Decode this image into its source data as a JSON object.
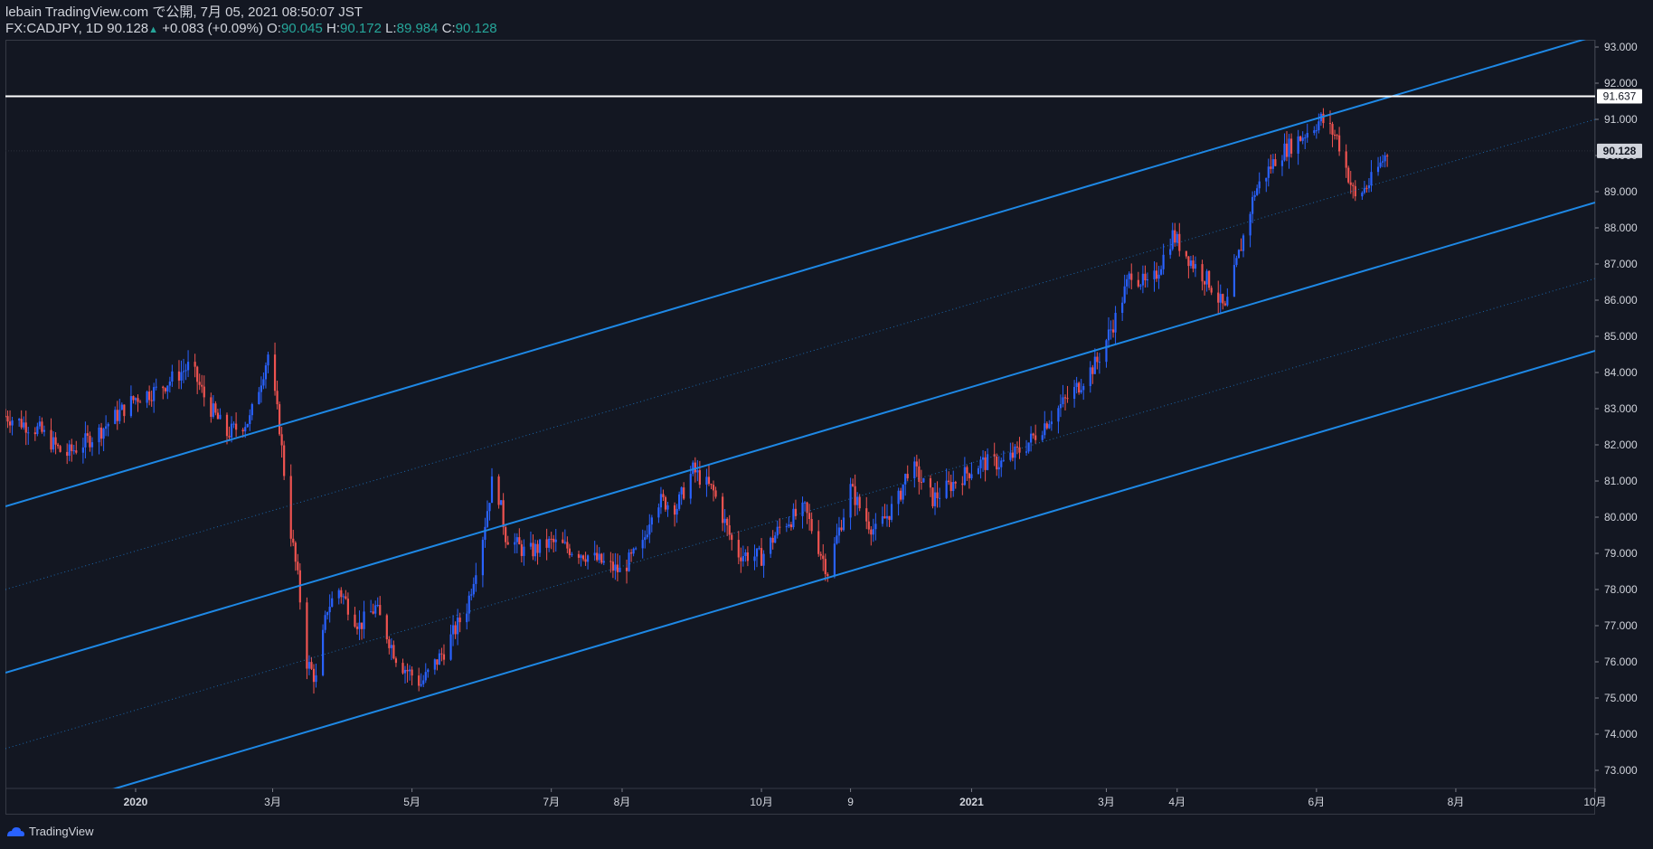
{
  "header": {
    "line1": "lebain TradingView.com で公開, 7月 05, 2021 08:50:07 JST",
    "symbol": "FX:CADJPY, 1D 90.128",
    "arrow": "▲",
    "change": "+0.083 (+0.09%)",
    "o_label": "O:",
    "o_value": "90.045",
    "h_label": "H:",
    "h_value": "90.172",
    "l_label": "L:",
    "l_value": "89.984",
    "c_label": "C:",
    "c_value": "90.128"
  },
  "footer": {
    "brand": "TradingView"
  },
  "colors": {
    "bg": "#131722",
    "up": "#2962ff",
    "down": "#ef5350",
    "channel": "#1e88e5",
    "level": "#ffffff",
    "text": "#d1d4dc"
  },
  "chart_data": {
    "type": "candlestick",
    "symbol": "FX:CADJPY",
    "interval": "1D",
    "ylim": [
      72.5,
      93.2
    ],
    "y_ticks": [
      "73.000",
      "74.000",
      "75.000",
      "76.000",
      "77.000",
      "78.000",
      "79.000",
      "80.000",
      "81.000",
      "82.000",
      "83.000",
      "84.000",
      "85.000",
      "86.000",
      "87.000",
      "88.000",
      "89.000",
      "90.000",
      "91.000",
      "92.000",
      "93.000"
    ],
    "x_ticks": [
      {
        "label": "2020",
        "date": "2020-01-01"
      },
      {
        "label": "3月",
        "date": "2020-03-01"
      },
      {
        "label": "5月",
        "date": "2020-05-01"
      },
      {
        "label": "7月",
        "date": "2020-07-01"
      },
      {
        "label": "8月",
        "date": "2020-08-01"
      },
      {
        "label": "10月",
        "date": "2020-10-01"
      },
      {
        "label": "9",
        "date": "2020-11-09"
      },
      {
        "label": "2021",
        "date": "2021-01-01"
      },
      {
        "label": "3月",
        "date": "2021-03-01"
      },
      {
        "label": "4月",
        "date": "2021-04-01"
      },
      {
        "label": "6月",
        "date": "2021-06-01"
      },
      {
        "label": "8月",
        "date": "2021-08-01"
      },
      {
        "label": "10月",
        "date": "2021-10-01"
      }
    ],
    "xlim": [
      "2019-11-05",
      "2021-10-01"
    ],
    "last_price": "90.128",
    "horizontal_level": {
      "label": "91.637",
      "value": 91.637
    },
    "channel_lines": [
      {
        "name": "upper",
        "p1": [
          "2019-11-05",
          80.3
        ],
        "p2": [
          "2021-10-01",
          93.3
        ],
        "style": "solid"
      },
      {
        "name": "upper-mid",
        "p1": [
          "2019-11-05",
          78.0
        ],
        "p2": [
          "2021-10-01",
          91.0
        ],
        "style": "dotted"
      },
      {
        "name": "middle",
        "p1": [
          "2019-11-05",
          75.7
        ],
        "p2": [
          "2021-10-01",
          88.7
        ],
        "style": "solid"
      },
      {
        "name": "lower-mid",
        "p1": [
          "2019-11-05",
          73.6
        ],
        "p2": [
          "2021-10-01",
          86.6
        ],
        "style": "dotted"
      },
      {
        "name": "lower",
        "p1": [
          "2019-11-05",
          71.6
        ],
        "p2": [
          "2021-10-01",
          84.6
        ],
        "style": "solid"
      }
    ],
    "path_points": [
      [
        "2019-11-05",
        82.8
      ],
      [
        "2019-11-20",
        82.4
      ],
      [
        "2019-12-01",
        81.7
      ],
      [
        "2019-12-15",
        82.3
      ],
      [
        "2020-01-01",
        83.3
      ],
      [
        "2020-01-10",
        83.5
      ],
      [
        "2020-01-25",
        84.2
      ],
      [
        "2020-02-01",
        83.2
      ],
      [
        "2020-02-10",
        82.3
      ],
      [
        "2020-02-20",
        82.7
      ],
      [
        "2020-02-28",
        84.5
      ],
      [
        "2020-03-04",
        82.5
      ],
      [
        "2020-03-08",
        80.0
      ],
      [
        "2020-03-12",
        78.3
      ],
      [
        "2020-03-16",
        76.0
      ],
      [
        "2020-03-20",
        75.5
      ],
      [
        "2020-03-25",
        77.5
      ],
      [
        "2020-03-30",
        78.0
      ],
      [
        "2020-04-08",
        77.0
      ],
      [
        "2020-04-15",
        77.5
      ],
      [
        "2020-04-25",
        76.0
      ],
      [
        "2020-05-05",
        75.4
      ],
      [
        "2020-05-15",
        76.3
      ],
      [
        "2020-05-25",
        77.5
      ],
      [
        "2020-06-01",
        79.5
      ],
      [
        "2020-06-06",
        81.3
      ],
      [
        "2020-06-11",
        79.5
      ],
      [
        "2020-06-20",
        79.0
      ],
      [
        "2020-07-01",
        79.3
      ],
      [
        "2020-07-15",
        79.0
      ],
      [
        "2020-07-31",
        78.5
      ],
      [
        "2020-08-10",
        79.2
      ],
      [
        "2020-08-15",
        80.5
      ],
      [
        "2020-08-25",
        80.3
      ],
      [
        "2020-09-01",
        81.3
      ],
      [
        "2020-09-10",
        80.7
      ],
      [
        "2020-09-20",
        79.0
      ],
      [
        "2020-10-01",
        78.9
      ],
      [
        "2020-10-10",
        79.8
      ],
      [
        "2020-10-20",
        80.2
      ],
      [
        "2020-10-30",
        78.5
      ],
      [
        "2020-11-09",
        80.8
      ],
      [
        "2020-11-15",
        80.0
      ],
      [
        "2020-11-20",
        79.6
      ],
      [
        "2020-11-30",
        80.5
      ],
      [
        "2020-12-05",
        81.5
      ],
      [
        "2020-12-15",
        80.5
      ],
      [
        "2020-12-25",
        81.0
      ],
      [
        "2021-01-05",
        81.5
      ],
      [
        "2021-01-15",
        81.5
      ],
      [
        "2021-01-25",
        82.0
      ],
      [
        "2021-02-05",
        82.8
      ],
      [
        "2021-02-15",
        83.5
      ],
      [
        "2021-02-25",
        84.3
      ],
      [
        "2021-03-05",
        85.5
      ],
      [
        "2021-03-12",
        86.8
      ],
      [
        "2021-03-20",
        86.3
      ],
      [
        "2021-03-30",
        87.8
      ],
      [
        "2021-04-08",
        87.0
      ],
      [
        "2021-04-15",
        86.5
      ],
      [
        "2021-04-22",
        85.7
      ],
      [
        "2021-04-27",
        87.0
      ],
      [
        "2021-05-05",
        89.0
      ],
      [
        "2021-05-15",
        90.0
      ],
      [
        "2021-05-25",
        90.5
      ],
      [
        "2021-06-03",
        91.0
      ],
      [
        "2021-06-10",
        90.5
      ],
      [
        "2021-06-18",
        88.8
      ],
      [
        "2021-06-25",
        89.3
      ],
      [
        "2021-07-02",
        90.1
      ]
    ]
  }
}
